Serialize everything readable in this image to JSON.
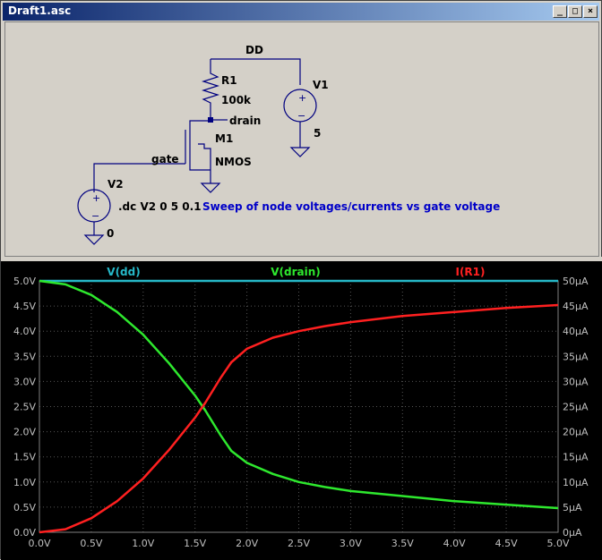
{
  "window": {
    "title": "Draft1.asc",
    "min_glyph": "_",
    "max_glyph": "□",
    "close_glyph": "×"
  },
  "schematic": {
    "net_dd": "DD",
    "r1_name": "R1",
    "r1_value": "100k",
    "v1_name": "V1",
    "v1_value": "5",
    "m1_name": "M1",
    "m1_model": "NMOS",
    "drain_label": "drain",
    "gate_label": "gate",
    "v2_name": "V2",
    "v2_value": "0",
    "directive": ".dc V2 0 5 0.1",
    "comment": "Sweep of node voltages/currents vs gate voltage"
  },
  "colors": {
    "schematic_wire": "#000080",
    "directive_text": "#000000",
    "comment_text": "#0000c8",
    "plot_bg": "#000000",
    "grid": "#555555",
    "axis_text": "#c0c0c0",
    "vdd": "#26b8c8",
    "vdrain": "#2ee82e",
    "ir1": "#ff2020"
  },
  "chart_data": {
    "type": "line",
    "xlabel": "",
    "ylabel": "",
    "xlim": [
      0,
      5
    ],
    "ylim": [
      0,
      5
    ],
    "y2lim": [
      0,
      50
    ],
    "x_ticks": [
      "0.0V",
      "0.5V",
      "1.0V",
      "1.5V",
      "2.0V",
      "2.5V",
      "3.0V",
      "3.5V",
      "4.0V",
      "4.5V",
      "5.0V"
    ],
    "y_ticks": [
      "0.0V",
      "0.5V",
      "1.0V",
      "1.5V",
      "2.0V",
      "2.5V",
      "3.0V",
      "3.5V",
      "4.0V",
      "4.5V",
      "5.0V"
    ],
    "y2_ticks": [
      "0µA",
      "5µA",
      "10µA",
      "15µA",
      "20µA",
      "25µA",
      "30µA",
      "35µA",
      "40µA",
      "45µA",
      "50µA"
    ],
    "grid": true,
    "x": [
      0,
      0.25,
      0.5,
      0.75,
      1.0,
      1.25,
      1.5,
      1.6,
      1.75,
      1.85,
      2.0,
      2.25,
      2.5,
      2.75,
      3.0,
      3.5,
      4.0,
      4.5,
      5.0
    ],
    "series": [
      {
        "name": "V(dd)",
        "axis": "left",
        "values": [
          5,
          5,
          5,
          5,
          5,
          5,
          5,
          5,
          5,
          5,
          5,
          5,
          5,
          5,
          5,
          5,
          5,
          5,
          5
        ]
      },
      {
        "name": "V(drain)",
        "axis": "left",
        "values": [
          5.0,
          4.93,
          4.72,
          4.38,
          3.93,
          3.36,
          2.72,
          2.42,
          1.92,
          1.62,
          1.38,
          1.16,
          1.0,
          0.9,
          0.82,
          0.72,
          0.62,
          0.55,
          0.48
        ]
      },
      {
        "name": "I(R1)",
        "axis": "right",
        "values": [
          0.0,
          0.6,
          2.8,
          6.2,
          10.7,
          16.4,
          22.8,
          25.8,
          30.8,
          33.8,
          36.5,
          38.7,
          40.0,
          41.0,
          41.8,
          43.0,
          43.8,
          44.6,
          45.2
        ]
      }
    ]
  }
}
